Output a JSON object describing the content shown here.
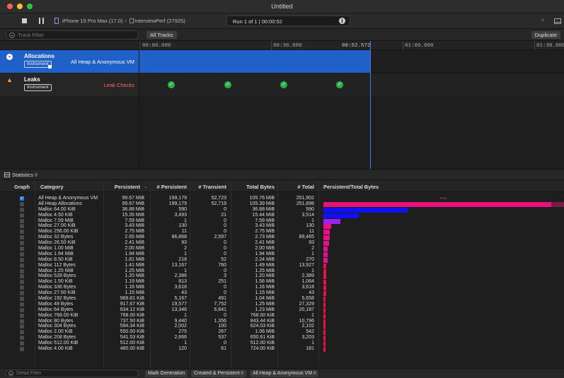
{
  "window": {
    "title": "Untitled"
  },
  "toolbar": {
    "device": "iPhone 15 Pro Max (17.0)",
    "process": "InterviewPerf (27925)",
    "run_label": "Run 1 of 1  |  00:00:52"
  },
  "filter": {
    "placeholder": "Track Filter",
    "all_tracks": "All Tracks",
    "duplicate": "Duplicate"
  },
  "ruler": {
    "ticks": [
      "00:00.000",
      "00:30.000",
      "01:00.000",
      "01:30.000"
    ],
    "playhead": "00:52.572"
  },
  "tracks": [
    {
      "name": "Allocations",
      "badge": "Instrument",
      "subtitle": "All Heap & Anonymous VM"
    },
    {
      "name": "Leaks",
      "badge": "Instrument",
      "subtitle": "Leak Checks"
    }
  ],
  "statistics": {
    "label": "Statistics ◊"
  },
  "table": {
    "headers": [
      "Graph",
      "Category",
      "Persistent",
      "# Persistent",
      "# Transient",
      "Total Bytes",
      "# Total",
      "Persistent/Total Bytes"
    ],
    "rows": [
      {
        "category": "All Heap & Anonymous VM",
        "persistent": "99.67 MiB",
        "n_persistent": "199,179",
        "n_transient": "52,723",
        "total_bytes": "105.76 MiB",
        "n_total": "251,902",
        "checked": true,
        "bar": 0
      },
      {
        "category": "All Heap Allocations",
        "persistent": "99.67 MiB",
        "n_persistent": "199,179",
        "n_transient": "52,719",
        "total_bytes": "105.39 MiB",
        "n_total": "251,898",
        "checked": false,
        "bar": 0.946
      },
      {
        "category": "Malloc 64.00 KiB",
        "persistent": "36.88 MiB",
        "n_persistent": "590",
        "n_transient": "0",
        "total_bytes": "36.88 MiB",
        "n_total": "590",
        "checked": false,
        "bar": 0.35
      },
      {
        "category": "Malloc 4.50 KiB",
        "persistent": "15.35 MiB",
        "n_persistent": "3,493",
        "n_transient": "21",
        "total_bytes": "15.44 MiB",
        "n_total": "3,514",
        "checked": false,
        "bar": 0.146
      },
      {
        "category": "Malloc 7.59 MiB",
        "persistent": "7.59 MiB",
        "n_persistent": "1",
        "n_transient": "0",
        "total_bytes": "7.59 MiB",
        "n_total": "1",
        "checked": false,
        "bar": 0.072
      },
      {
        "category": "Malloc 27.00 KiB",
        "persistent": "3.43 MiB",
        "n_persistent": "130",
        "n_transient": "0",
        "total_bytes": "3.43 MiB",
        "n_total": "130",
        "checked": false,
        "bar": 0.033
      },
      {
        "category": "Malloc 256.00 KiB",
        "persistent": "2.75 MiB",
        "n_persistent": "11",
        "n_transient": "0",
        "total_bytes": "2.75 MiB",
        "n_total": "11",
        "checked": false,
        "bar": 0.026
      },
      {
        "category": "Malloc 32 Bytes",
        "persistent": "2.65 MiB",
        "n_persistent": "86,868",
        "n_transient": "2,597",
        "total_bytes": "2.73 MiB",
        "n_total": "89,465",
        "checked": false,
        "bar": 0.025
      },
      {
        "category": "Malloc 26.50 KiB",
        "persistent": "2.41 MiB",
        "n_persistent": "93",
        "n_transient": "0",
        "total_bytes": "2.41 MiB",
        "n_total": "93",
        "checked": false,
        "bar": 0.023
      },
      {
        "category": "Malloc 1.00 MiB",
        "persistent": "2.00 MiB",
        "n_persistent": "2",
        "n_transient": "0",
        "total_bytes": "2.00 MiB",
        "n_total": "2",
        "checked": false,
        "bar": 0.019
      },
      {
        "category": "Malloc 1.94 MiB",
        "persistent": "1.94 MiB",
        "n_persistent": "1",
        "n_transient": "0",
        "total_bytes": "1.94 MiB",
        "n_total": "1",
        "checked": false,
        "bar": 0.018
      },
      {
        "category": "Malloc 8.50 KiB",
        "persistent": "1.81 MiB",
        "n_persistent": "218",
        "n_transient": "52",
        "total_bytes": "2.24 MiB",
        "n_total": "270",
        "checked": false,
        "bar": 0.017
      },
      {
        "category": "Malloc 112 Bytes",
        "persistent": "1.41 MiB",
        "n_persistent": "13,167",
        "n_transient": "760",
        "total_bytes": "1.49 MiB",
        "n_total": "13,927",
        "checked": false,
        "bar": 0.013
      },
      {
        "category": "Malloc 1.25 MiB",
        "persistent": "1.25 MiB",
        "n_persistent": "1",
        "n_transient": "0",
        "total_bytes": "1.25 MiB",
        "n_total": "1",
        "checked": false,
        "bar": 0.012
      },
      {
        "category": "Malloc 528 Bytes",
        "persistent": "1.20 MiB",
        "n_persistent": "2,386",
        "n_transient": "3",
        "total_bytes": "1.20 MiB",
        "n_total": "2,389",
        "checked": false,
        "bar": 0.011
      },
      {
        "category": "Malloc 1.50 KiB",
        "persistent": "1.19 MiB",
        "n_persistent": "813",
        "n_transient": "251",
        "total_bytes": "1.56 MiB",
        "n_total": "1,064",
        "checked": false,
        "bar": 0.011
      },
      {
        "category": "Malloc 336 Bytes",
        "persistent": "1.16 MiB",
        "n_persistent": "3,618",
        "n_transient": "0",
        "total_bytes": "1.16 MiB",
        "n_total": "3,618",
        "checked": false,
        "bar": 0.011
      },
      {
        "category": "Malloc 27.50 KiB",
        "persistent": "1.15 MiB",
        "n_persistent": "43",
        "n_transient": "0",
        "total_bytes": "1.15 MiB",
        "n_total": "43",
        "checked": false,
        "bar": 0.011
      },
      {
        "category": "Malloc 192 Bytes",
        "persistent": "968.81 KiB",
        "n_persistent": "5,167",
        "n_transient": "491",
        "total_bytes": "1.04 MiB",
        "n_total": "5,658",
        "checked": false,
        "bar": 0.009
      },
      {
        "category": "Malloc 48 Bytes",
        "persistent": "917.67 KiB",
        "n_persistent": "19,577",
        "n_transient": "7,752",
        "total_bytes": "1.25 MiB",
        "n_total": "27,329",
        "checked": false,
        "bar": 0.009
      },
      {
        "category": "Malloc 64 Bytes",
        "persistent": "834.12 KiB",
        "n_persistent": "13,346",
        "n_transient": "6,841",
        "total_bytes": "1.23 MiB",
        "n_total": "20,187",
        "checked": false,
        "bar": 0.008
      },
      {
        "category": "Malloc 768.00 KiB",
        "persistent": "768.00 KiB",
        "n_persistent": "1",
        "n_transient": "0",
        "total_bytes": "768.00 KiB",
        "n_total": "1",
        "checked": false,
        "bar": 0.007
      },
      {
        "category": "Malloc 80 Bytes",
        "persistent": "737.50 KiB",
        "n_persistent": "9,440",
        "n_transient": "1,356",
        "total_bytes": "843.44 KiB",
        "n_total": "10,796",
        "checked": false,
        "bar": 0.007
      },
      {
        "category": "Malloc 304 Bytes",
        "persistent": "594.34 KiB",
        "n_persistent": "2,002",
        "n_transient": "100",
        "total_bytes": "624.03 KiB",
        "n_total": "2,102",
        "checked": false,
        "bar": 0.006
      },
      {
        "category": "Malloc 2.00 KiB",
        "persistent": "550.00 KiB",
        "n_persistent": "275",
        "n_transient": "267",
        "total_bytes": "1.06 MiB",
        "n_total": "542",
        "checked": false,
        "bar": 0.005
      },
      {
        "category": "Malloc 208 Bytes",
        "persistent": "541.53 KiB",
        "n_persistent": "2,666",
        "n_transient": "537",
        "total_bytes": "650.61 KiB",
        "n_total": "3,203",
        "checked": false,
        "bar": 0.005
      },
      {
        "category": "Malloc 512.00 KiB",
        "persistent": "512.00 KiB",
        "n_persistent": "1",
        "n_transient": "0",
        "total_bytes": "512.00 KiB",
        "n_total": "1",
        "checked": false,
        "bar": 0.005
      },
      {
        "category": "Malloc 4.00 KiB",
        "persistent": "480.00 KiB",
        "n_persistent": "120",
        "n_transient": "61",
        "total_bytes": "724.00 KiB",
        "n_total": "181",
        "checked": false,
        "bar": 0.005
      }
    ]
  },
  "bottom": {
    "placeholder": "Detail Filter",
    "mark_generation": "Mark Generation",
    "mode": "Created & Persistent ◊",
    "scope": "All Heap & Anonymous VM ◊"
  },
  "colors": {
    "accent": "#1f61c9",
    "bar_pink": "#e8107c",
    "bar_blue": "#1010f0",
    "bar_purple": "#a020f0",
    "bar_red": "#e8104c",
    "check_green": "#29b24a"
  }
}
